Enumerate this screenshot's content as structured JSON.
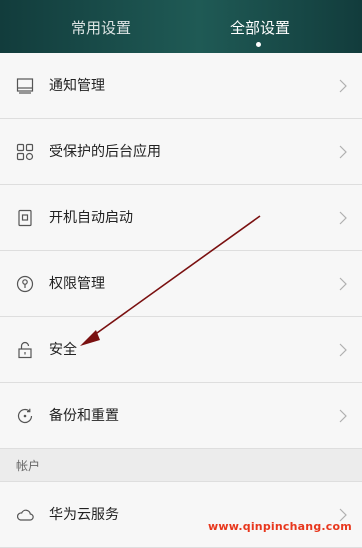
{
  "header": {
    "tabs": [
      {
        "label": "常用设置",
        "active": false
      },
      {
        "label": "全部设置",
        "active": true
      }
    ]
  },
  "list": {
    "items": [
      {
        "label": "通知管理",
        "icon": "notification-icon"
      },
      {
        "label": "受保护的后台应用",
        "icon": "protected-apps-icon"
      },
      {
        "label": "开机自动启动",
        "icon": "autostart-icon"
      },
      {
        "label": "权限管理",
        "icon": "permission-icon"
      },
      {
        "label": "安全",
        "icon": "lock-icon"
      },
      {
        "label": "备份和重置",
        "icon": "backup-reset-icon"
      }
    ],
    "section": {
      "label": "帐户"
    },
    "account_items": [
      {
        "label": "华为云服务",
        "icon": "cloud-icon"
      }
    ]
  },
  "watermark": "www.qinpinchang.com",
  "colors": {
    "header_bg": "#1a4a47",
    "arrow": "#7a1010",
    "watermark": "#e8371d"
  }
}
